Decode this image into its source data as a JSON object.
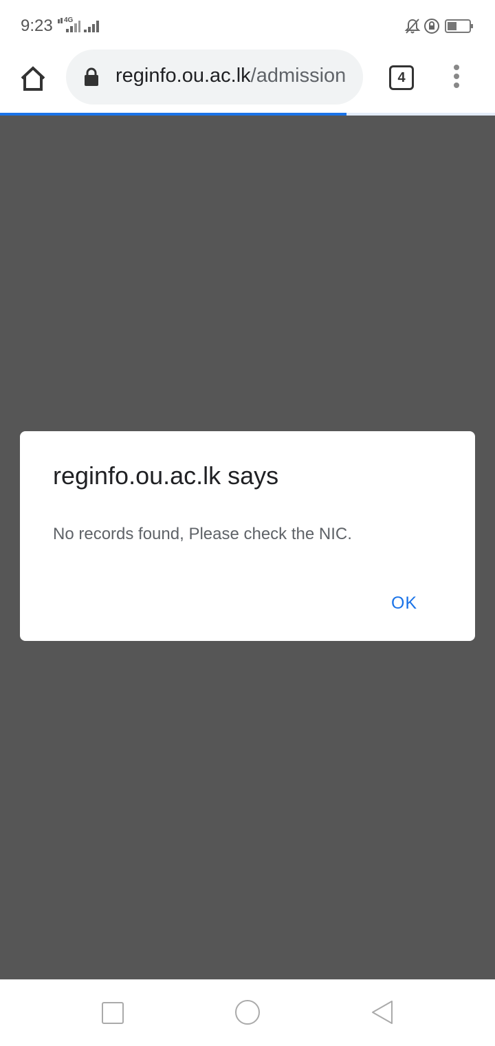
{
  "status_bar": {
    "time": "9:23",
    "network": "4G",
    "icons": [
      "signal-icon",
      "mute-icon",
      "rotation-lock-icon",
      "battery-icon"
    ]
  },
  "browser": {
    "url_host": "reginfo.ou.ac.lk",
    "url_path": "/admission",
    "tab_count": "4",
    "load_progress": 0.7,
    "accent_color": "#1a73e8"
  },
  "dialog": {
    "title": "reginfo.ou.ac.lk says",
    "message": "No records found, Please check the NIC.",
    "ok_label": "OK"
  },
  "nav_bar": {
    "buttons": [
      "recents-button",
      "home-button",
      "back-button"
    ]
  }
}
